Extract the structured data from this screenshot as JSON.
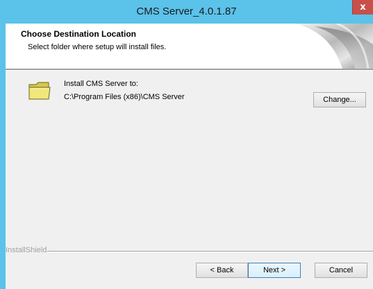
{
  "window": {
    "title": "CMS Server_4.0.1.87",
    "close_glyph": "x"
  },
  "header": {
    "title": "Choose Destination Location",
    "subtitle": "Select folder where setup will install files."
  },
  "destination": {
    "label": "Install CMS Server to:",
    "path": "C:\\Program Files (x86)\\CMS Server",
    "change_label": "Change..."
  },
  "footer": {
    "brand": "InstallShield",
    "back_label": "< Back",
    "next_label": "Next >",
    "cancel_label": "Cancel"
  },
  "icons": {
    "folder": "folder-icon",
    "header_art": "page-curl-art"
  },
  "colors": {
    "titlebar": "#5bc2ea",
    "close_button": "#c7504a",
    "dialog_background": "#f0f0f0",
    "header_background": "#ffffff"
  }
}
